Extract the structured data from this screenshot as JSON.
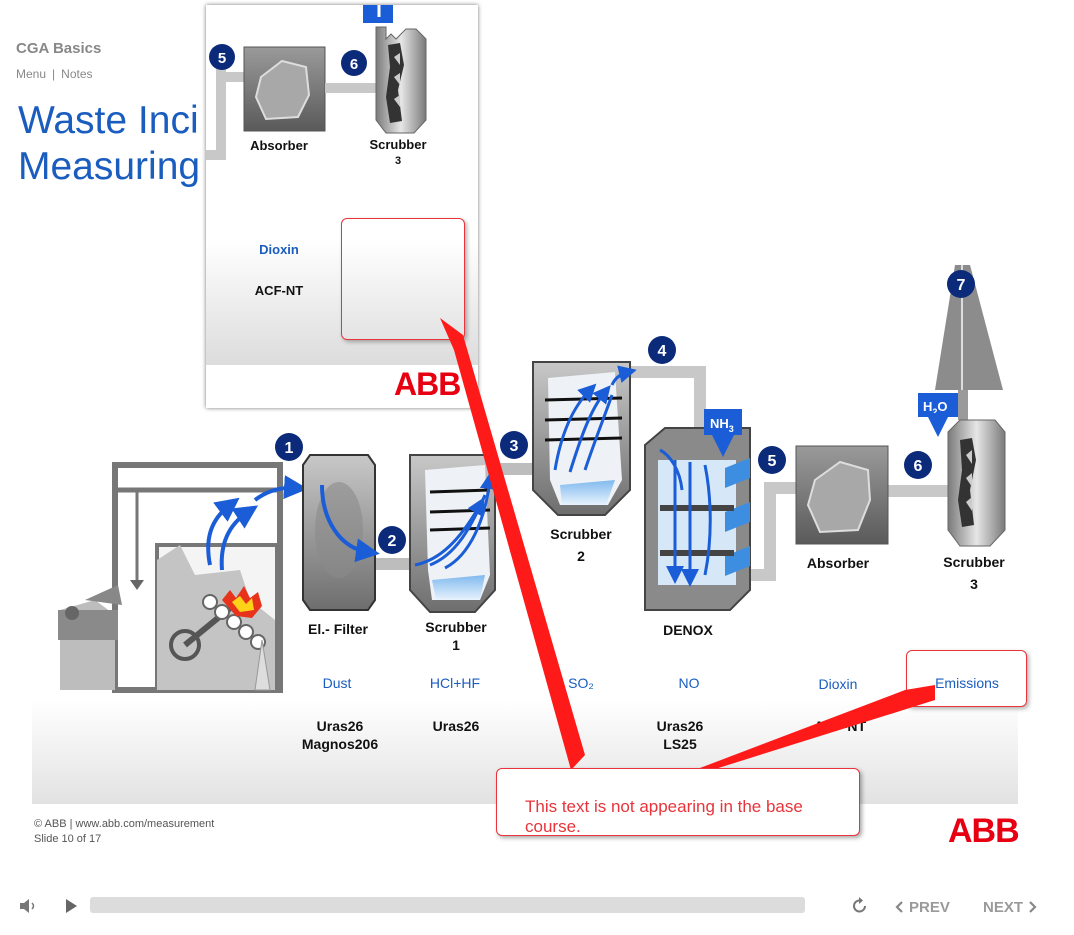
{
  "header": {
    "course_title": "CGA Basics",
    "links": [
      "Menu",
      "Notes"
    ],
    "link_separator": "|"
  },
  "slide": {
    "title_line1": "Waste Inci",
    "title_line2": "Measuring"
  },
  "diagram": {
    "steps": [
      "1",
      "2",
      "3",
      "4",
      "5",
      "6",
      "7"
    ],
    "units": {
      "filter": "El.- Filter",
      "scrubber1": [
        "Scrubber",
        "1"
      ],
      "scrubber2": [
        "Scrubber",
        "2"
      ],
      "denox": "DENOX",
      "absorber": "Absorber",
      "scrubber3": [
        "Scrubber",
        "3"
      ]
    },
    "chemical_inputs": {
      "nh3": {
        "base": "NH",
        "sub": "3"
      },
      "h2o": {
        "base": "H",
        "sub": "2",
        "tail": "O"
      }
    }
  },
  "measurements": {
    "components": [
      "Dust",
      "HCl+HF",
      "SO₂",
      "NO",
      "Dioxin",
      "Emissions"
    ],
    "analyzers": [
      [
        "Uras26",
        "Magnos206"
      ],
      [
        "Uras26"
      ],
      [
        "Uras26",
        "LS25"
      ],
      [
        "ACF-NT"
      ]
    ]
  },
  "popup": {
    "step_a": "5",
    "step_b": "6",
    "absorber_label": "Absorber",
    "scrubber_label": [
      "Scrubber",
      "3"
    ],
    "component": "Dioxin",
    "analyzer": "ACF-NT",
    "logo": "ABB"
  },
  "annotation": {
    "text": "This text is not appearing in the base course."
  },
  "footer": {
    "copyright": "© ABB | www.abb.com/measurement",
    "slide_counter": "Slide 10 of 17",
    "logo": "ABB"
  },
  "player": {
    "prev_label": "PREV",
    "next_label": "NEXT",
    "progress": 0
  },
  "colors": {
    "title_blue": "#1a5dbf",
    "step_navy": "#0b2a7a",
    "annotation_red": "#e8343a",
    "abb_red": "#e60012"
  }
}
